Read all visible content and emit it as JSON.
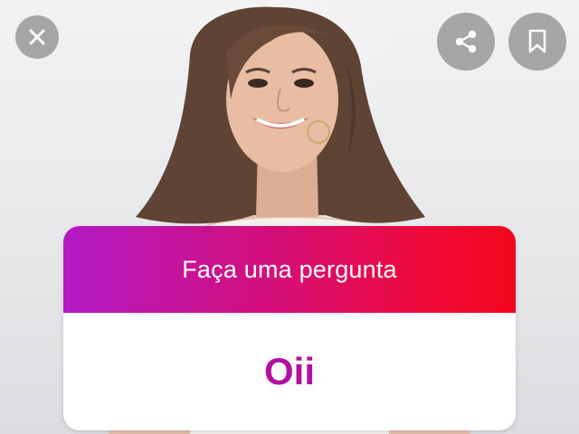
{
  "question_sticker": {
    "prompt": "Faça uma pergunta",
    "answer": "Oii",
    "gradient_colors": [
      "#b31ac4",
      "#d30f7c",
      "#f3061b"
    ],
    "answer_color": "#b1119e"
  },
  "controls": {
    "close_icon": "close-icon",
    "share_icon": "share-icon",
    "bookmark_icon": "bookmark-icon"
  }
}
